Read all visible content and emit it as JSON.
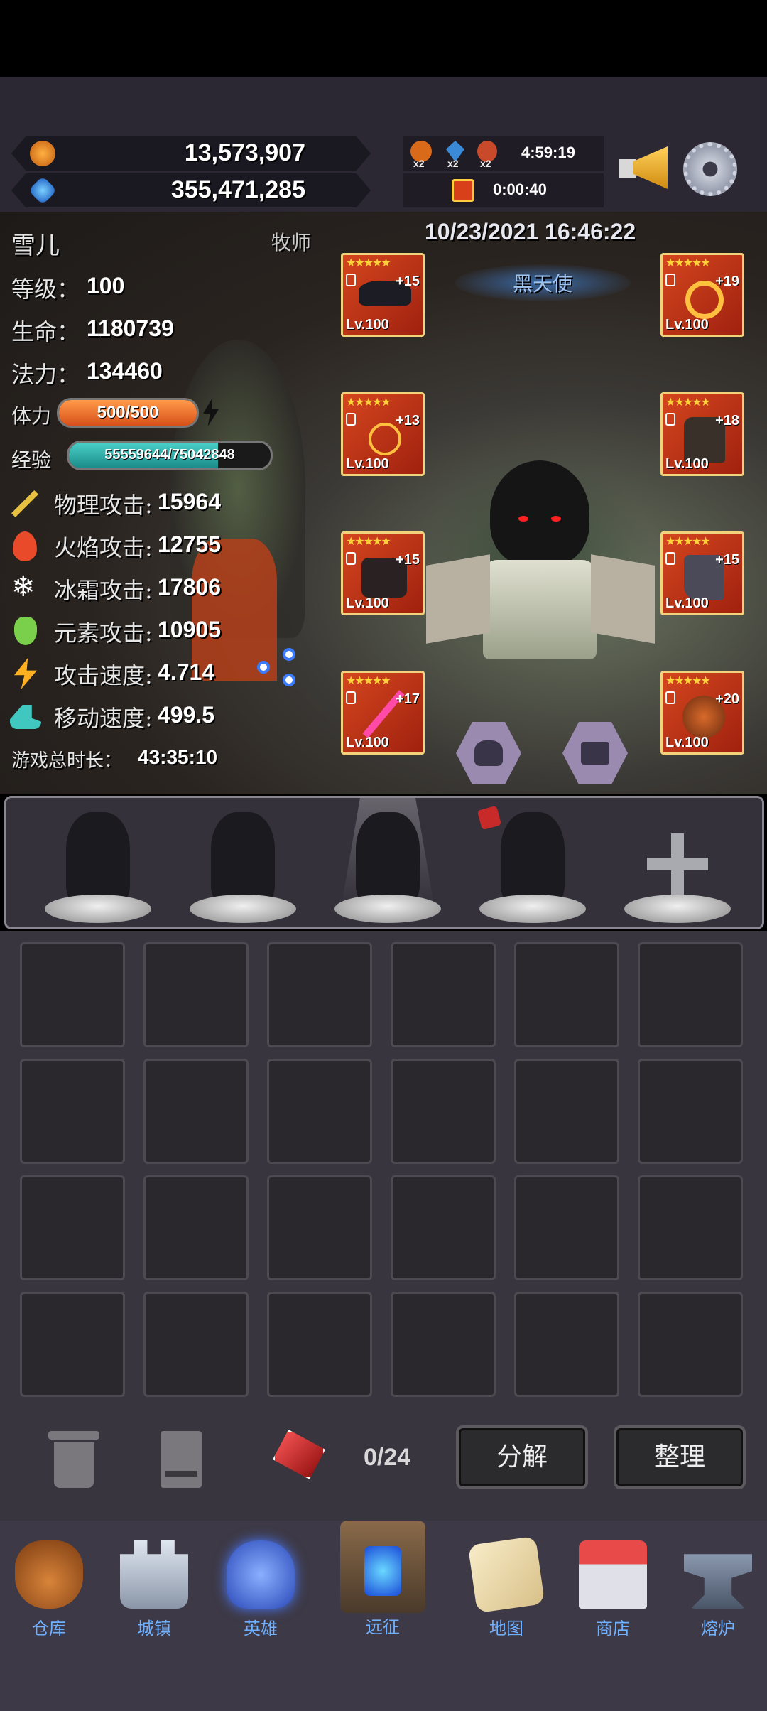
{
  "resources": {
    "gold": "13,573,907",
    "gems": "355,471,285"
  },
  "boosts": [
    {
      "icon": "gold-boost-icon",
      "mult": "x2"
    },
    {
      "icon": "gem-boost-icon",
      "mult": "x2"
    },
    {
      "icon": "exp-boost-icon",
      "mult": "x2"
    }
  ],
  "timers": {
    "boost_timer": "4:59:19",
    "gift_timer": "0:00:40"
  },
  "datetime": "10/23/2021 16:46:22",
  "hero": {
    "name": "雪儿",
    "class": "牧师",
    "skin_name": "黑天使",
    "level_label": "等级：",
    "level": "100",
    "hp_label": "生命：",
    "hp": "1180739",
    "mp_label": "法力：",
    "mp": "134460",
    "stamina_label": "体力",
    "stamina": "500/500",
    "stamina_fraction": 1.0,
    "exp_label": "经验",
    "exp": "55559644/75042848",
    "exp_fraction": 0.74,
    "stats": [
      {
        "icon": "sword-icon",
        "label": "物理攻击:",
        "value": "15964"
      },
      {
        "icon": "fire-icon",
        "label": "火焰攻击:",
        "value": "12755"
      },
      {
        "icon": "snowflake-icon",
        "label": "冰霜攻击:",
        "value": "17806"
      },
      {
        "icon": "potion-icon",
        "label": "元素攻击:",
        "value": "10905"
      },
      {
        "icon": "lightning-icon",
        "label": "攻击速度:",
        "value": "4.714"
      },
      {
        "icon": "boot-icon",
        "label": "移动速度:",
        "value": "499.5"
      }
    ],
    "playtime_label": "游戏总时长：",
    "playtime": "43:35:10"
  },
  "equipment": {
    "left": [
      {
        "name": "helmet",
        "plus": "+15",
        "lv": "Lv.100",
        "stars": "★★★★★"
      },
      {
        "name": "amulet",
        "plus": "+13",
        "lv": "Lv.100",
        "stars": "★★★★★"
      },
      {
        "name": "gloves",
        "plus": "+15",
        "lv": "Lv.100",
        "stars": "★★★★★"
      },
      {
        "name": "staff",
        "plus": "+17",
        "lv": "Lv.100",
        "stars": "★★★★★"
      }
    ],
    "right": [
      {
        "name": "ring",
        "plus": "+19",
        "lv": "Lv.100",
        "stars": "★★★★★"
      },
      {
        "name": "armor",
        "plus": "+18",
        "lv": "Lv.100",
        "stars": "★★★★★"
      },
      {
        "name": "boots",
        "plus": "+15",
        "lv": "Lv.100",
        "stars": "★★★★★"
      },
      {
        "name": "shield",
        "plus": "+20",
        "lv": "Lv.100",
        "stars": "★★★★★"
      }
    ]
  },
  "inventory": {
    "count": "0/24"
  },
  "buttons": {
    "decompose": "分解",
    "sort": "整理"
  },
  "nav": [
    {
      "label": "仓库",
      "icon": "bag-icon",
      "color": "#b86a2a"
    },
    {
      "label": "城镇",
      "icon": "castle-icon",
      "color": "#9aa6b8"
    },
    {
      "label": "英雄",
      "icon": "helmet-icon",
      "color": "#4e72d8"
    },
    {
      "label": "远征",
      "icon": "portal-icon",
      "color": "#2a6ad8"
    },
    {
      "label": "地图",
      "icon": "map-icon",
      "color": "#e8d7a8"
    },
    {
      "label": "商店",
      "icon": "shop-icon",
      "color": "#d44a4a"
    },
    {
      "label": "熔炉",
      "icon": "anvil-icon",
      "color": "#7a8aa0"
    }
  ]
}
